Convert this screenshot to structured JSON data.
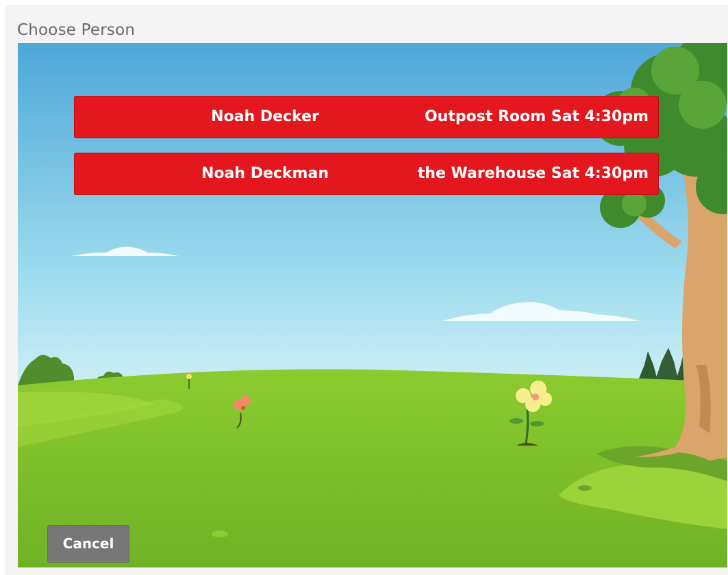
{
  "page": {
    "title": "Choose Person"
  },
  "people": [
    {
      "name": "Noah Decker",
      "location": "Outpost Room Sat 4:30pm"
    },
    {
      "name": "Noah Deckman",
      "location": "the Warehouse Sat 4:30pm"
    }
  ],
  "actions": {
    "cancel_label": "Cancel"
  },
  "colors": {
    "person_button": "#e4161e",
    "cancel_button": "#777777",
    "sky_top": "#4fa8d8",
    "sky_bottom": "#d9f3f6",
    "grass": "#7fbf2a"
  }
}
